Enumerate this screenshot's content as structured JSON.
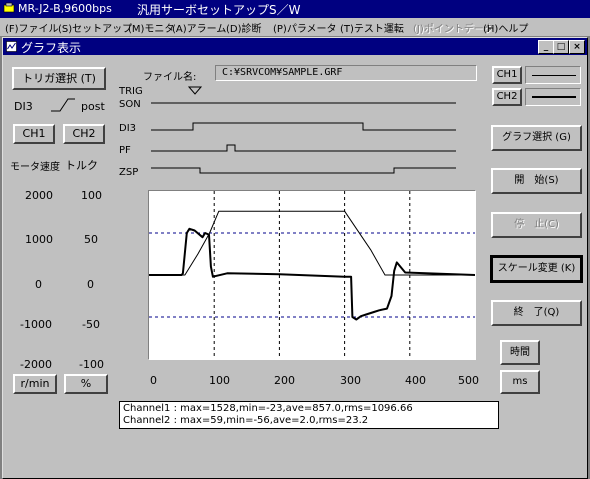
{
  "window": {
    "app_info": "MR-J2-B,9600bps",
    "title": "汎用サーボセットアップS／W"
  },
  "menu": [
    {
      "label": "(F)ファイル",
      "enabled": true
    },
    {
      "label": "(S)セットアップ",
      "enabled": true
    },
    {
      "label": "(M)モニタ",
      "enabled": true
    },
    {
      "label": "(A)アラーム",
      "enabled": true
    },
    {
      "label": "(D)診断",
      "enabled": true
    },
    {
      "label": "(P)パラメータ",
      "enabled": true
    },
    {
      "label": "(T)テスト運転",
      "enabled": true
    },
    {
      "label": "(J)ポイントデータ",
      "enabled": false
    },
    {
      "label": "(H)ヘルプ",
      "enabled": true
    }
  ],
  "child": {
    "title": "グラフ表示",
    "minimize": "_",
    "maximize": "□",
    "close": "×"
  },
  "trigger_button": "トリガ選択 (T)",
  "trigger": {
    "signal": "DI3",
    "edge": "post"
  },
  "ch_buttons": {
    "ch1": "CH1",
    "ch2": "CH2"
  },
  "file": {
    "label": "ファイル名:",
    "value": "C:¥SRVCOM¥SAMPLE.GRF"
  },
  "legend": [
    {
      "label": "CH1",
      "line_width": 1
    },
    {
      "label": "CH2",
      "line_width": 2
    }
  ],
  "signals": {
    "trig_label": "TRIG",
    "rows": [
      "SON",
      "DI3",
      "PF",
      "ZSP"
    ]
  },
  "yaxis": {
    "left_title": "モータ速度",
    "right_title": "トルク",
    "left_ticks": [
      "2000",
      "1000",
      "0",
      "-1000",
      "-2000"
    ],
    "right_ticks": [
      "100",
      "50",
      "0",
      "-50",
      "-100"
    ],
    "left_unit": "r/min",
    "right_unit": "%"
  },
  "xaxis": {
    "ticks": [
      "0",
      "100",
      "200",
      "300",
      "400",
      "500"
    ],
    "unit_label": "時間",
    "unit": "ms"
  },
  "buttons": {
    "graph_select": "グラフ選択 (G)",
    "start": "開　始(S)",
    "stop": "停　止(C)",
    "scale_change": "スケール変更 (K)",
    "end": "終　了(Q)"
  },
  "info": [
    "Channel1 : max=1528,min=-23,ave=857.0,rms=1096.66",
    "Channel2 : max=59,min=-56,ave=2.0,rms=23.2"
  ],
  "chart_data": {
    "type": "line",
    "xlim": [
      0,
      500
    ],
    "series": [
      {
        "name": "CH1",
        "unit": "r/min",
        "ylim": [
          -2000,
          2000
        ],
        "x": [
          0,
          40,
          55,
          75,
          93,
          107,
          300,
          340,
          362,
          385,
          500
        ],
        "y": [
          0,
          0,
          0,
          500,
          1000,
          1520,
          1520,
          600,
          0,
          0,
          0
        ]
      },
      {
        "name": "CH2",
        "unit": "%",
        "ylim": [
          -100,
          100
        ],
        "x": [
          0,
          50,
          52,
          58,
          62,
          70,
          82,
          86,
          92,
          95,
          98,
          120,
          200,
          300,
          310,
          312,
          318,
          325,
          333,
          345,
          353,
          365,
          372,
          376,
          380,
          393,
          500
        ],
        "y": [
          0,
          0,
          2,
          50,
          55,
          53,
          45,
          50,
          48,
          10,
          -2,
          2,
          1,
          -2,
          -2,
          -50,
          -53,
          -49,
          -47,
          -44,
          -42,
          -40,
          -25,
          5,
          15,
          3,
          0
        ]
      }
    ]
  }
}
